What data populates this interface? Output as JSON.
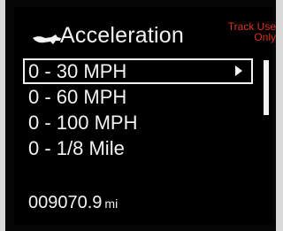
{
  "header": {
    "icon": "pony-icon",
    "title": "Acceleration",
    "track_note_line1": "Track Use",
    "track_note_line2": "Only",
    "track_note_color": "#d9321e"
  },
  "menu": {
    "items": [
      {
        "label": "0 - 30 MPH",
        "selected": true,
        "icon": "chevron-right-icon"
      },
      {
        "label": "0 - 60 MPH"
      },
      {
        "label": "0 - 100 MPH"
      },
      {
        "label": "0 - 1/8 Mile"
      }
    ]
  },
  "odometer": {
    "value": "009070.9",
    "unit": "mi"
  }
}
